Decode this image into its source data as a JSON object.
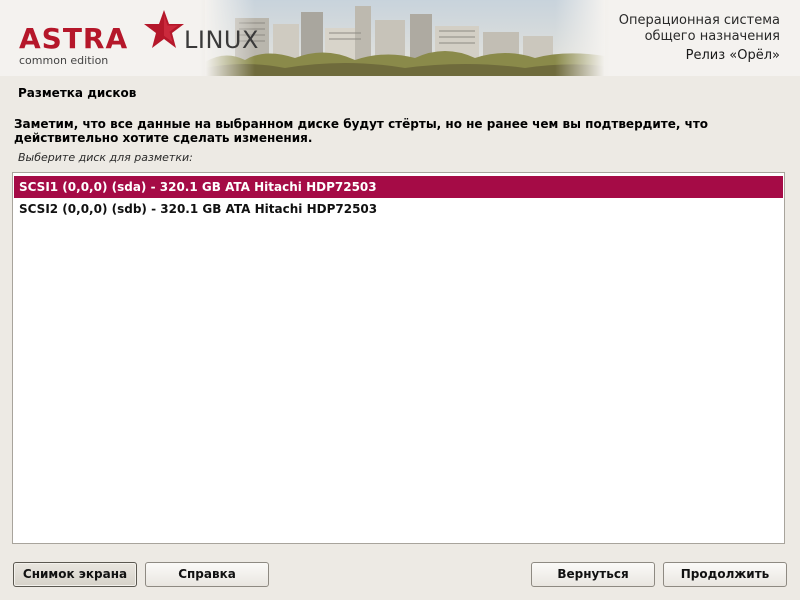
{
  "header": {
    "logo_brand": "ASTRA",
    "logo_product": "LINUX",
    "logo_edition": "common edition",
    "os_line1": "Операционная система",
    "os_line2": "общего назначения",
    "release": "Релиз «Орёл»"
  },
  "page": {
    "title": "Разметка дисков",
    "warning": "Заметим, что все данные на выбранном диске будут стёрты, но не ранее чем вы подтвердите, что действительно хотите сделать изменения.",
    "list_label": "Выберите диск для разметки:"
  },
  "disks": [
    {
      "label": "SCSI1 (0,0,0) (sda) - 320.1 GB ATA Hitachi HDP72503",
      "selected": true
    },
    {
      "label": "SCSI2 (0,0,0) (sdb) - 320.1 GB ATA Hitachi HDP72503",
      "selected": false
    }
  ],
  "buttons": {
    "screenshot": "Снимок экрана",
    "help": "Справка",
    "back": "Вернуться",
    "continue": "Продолжить"
  },
  "colors": {
    "accent_selected": "#a50b46",
    "brand_red": "#b5172a",
    "background": "#edeae4"
  }
}
